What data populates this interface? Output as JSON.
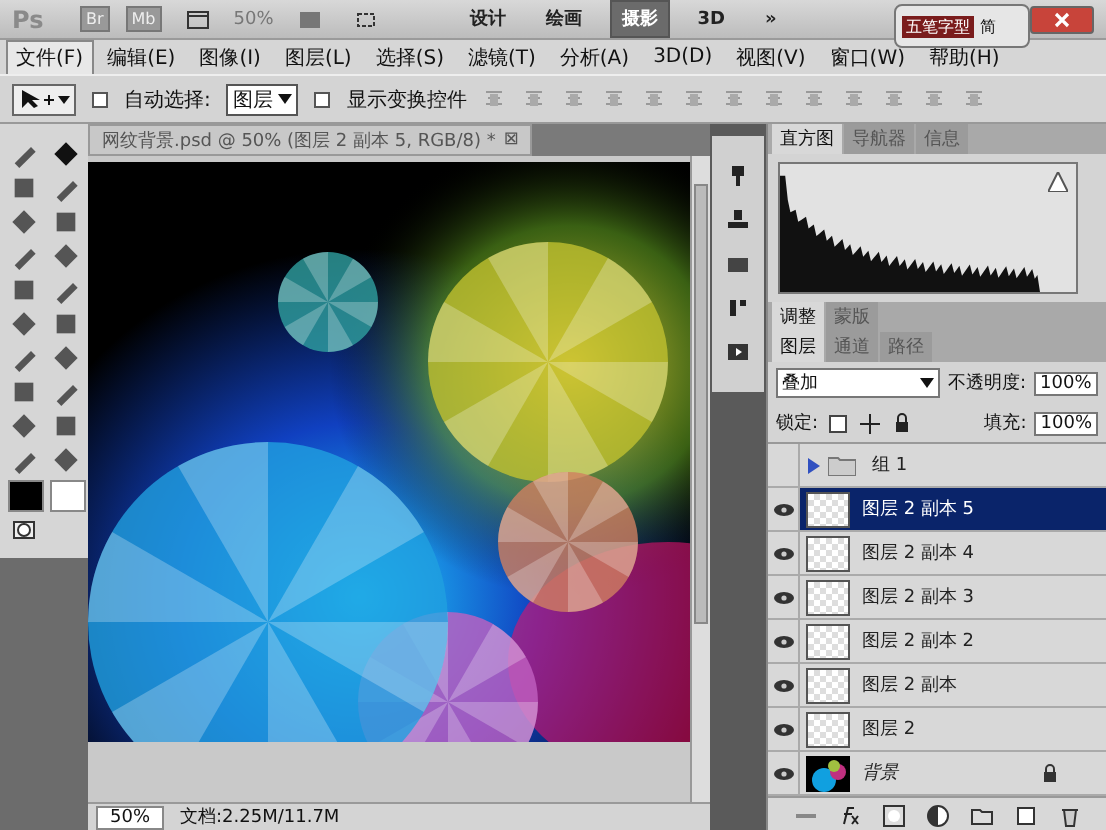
{
  "app_bar": {
    "logo": "Ps",
    "bridge": "Br",
    "mini_bridge": "Mb",
    "zoom": "50%",
    "workspaces": [
      {
        "label": "设计",
        "selected": false
      },
      {
        "label": "绘画",
        "selected": false
      },
      {
        "label": "摄影",
        "selected": true
      },
      {
        "label": "3D",
        "selected": false
      }
    ],
    "more": "»",
    "ime": "五笔字型",
    "ime_mode": "简"
  },
  "menu": [
    {
      "label": "文件(F)",
      "selected": true
    },
    {
      "label": "编辑(E)",
      "selected": false
    },
    {
      "label": "图像(I)",
      "selected": false
    },
    {
      "label": "图层(L)",
      "selected": false
    },
    {
      "label": "选择(S)",
      "selected": false
    },
    {
      "label": "滤镜(T)",
      "selected": false
    },
    {
      "label": "分析(A)",
      "selected": false
    },
    {
      "label": "3D(D)",
      "selected": false
    },
    {
      "label": "视图(V)",
      "selected": false
    },
    {
      "label": "窗口(W)",
      "selected": false
    },
    {
      "label": "帮助(H)",
      "selected": false
    }
  ],
  "options": {
    "auto_select": {
      "label": "自动选择:",
      "checked": false
    },
    "auto_select_target": "图层",
    "show_transform": {
      "label": "显示变换控件",
      "checked": false
    }
  },
  "document": {
    "tab": "网纹背景.psd @ 50% (图层 2 副本 5, RGB/8) *",
    "close": "⊠"
  },
  "status_bar": {
    "zoom": "50%",
    "info": "文档:2.25M/11.7M"
  },
  "panels": {
    "top_tabs": [
      {
        "label": "直方图",
        "selected": true
      },
      {
        "label": "导航器",
        "selected": false
      },
      {
        "label": "信息",
        "selected": false
      }
    ],
    "mid_tabs": [
      {
        "label": "调整",
        "selected": true
      },
      {
        "label": "蒙版",
        "selected": false
      }
    ],
    "layer_tabs": [
      {
        "label": "图层",
        "selected": true
      },
      {
        "label": "通道",
        "selected": false
      },
      {
        "label": "路径",
        "selected": false
      }
    ],
    "blend_mode": "叠加",
    "opacity_label": "不透明度:",
    "opacity": "100%",
    "lock_label": "锁定:",
    "fill_label": "填充:",
    "fill": "100%",
    "layers": [
      {
        "kind": "group",
        "name": "组 1",
        "visible": false,
        "selected": false
      },
      {
        "kind": "layer",
        "name": "图层 2 副本 5",
        "visible": true,
        "selected": true
      },
      {
        "kind": "layer",
        "name": "图层 2 副本 4",
        "visible": true,
        "selected": false
      },
      {
        "kind": "layer",
        "name": "图层 2 副本 3",
        "visible": true,
        "selected": false
      },
      {
        "kind": "layer",
        "name": "图层 2 副本 2",
        "visible": true,
        "selected": false
      },
      {
        "kind": "layer",
        "name": "图层 2 副本",
        "visible": true,
        "selected": false
      },
      {
        "kind": "layer",
        "name": "图层 2",
        "visible": true,
        "selected": false
      },
      {
        "kind": "background",
        "name": "背景",
        "visible": true,
        "selected": false
      }
    ]
  }
}
